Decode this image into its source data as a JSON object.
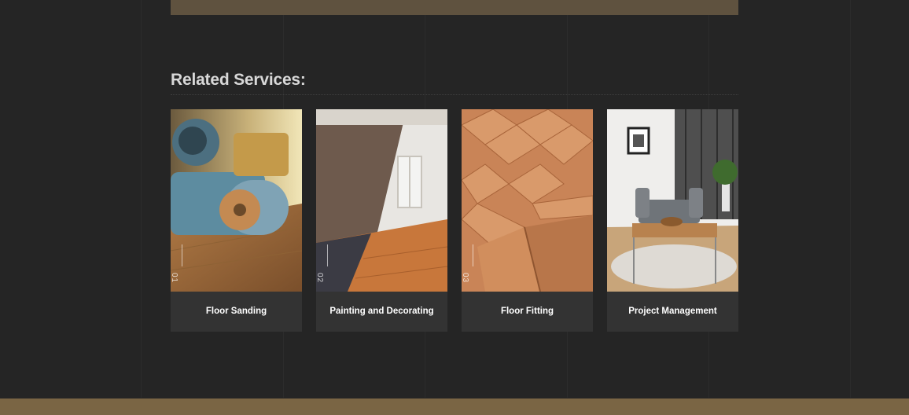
{
  "header": {
    "accent_color": "#5f523f"
  },
  "footer": {
    "accent_color": "#7a6544"
  },
  "section": {
    "title": "Related Services:"
  },
  "services": [
    {
      "label": "Floor Sanding",
      "number": "01",
      "image_icon": "floor-sander-image"
    },
    {
      "label": "Painting and Decorating",
      "number": "02",
      "image_icon": "room-renovation-image"
    },
    {
      "label": "Floor Fitting",
      "number": "03",
      "image_icon": "parquet-floor-image"
    },
    {
      "label": "Project Management",
      "number": "",
      "image_icon": "living-room-image"
    }
  ]
}
